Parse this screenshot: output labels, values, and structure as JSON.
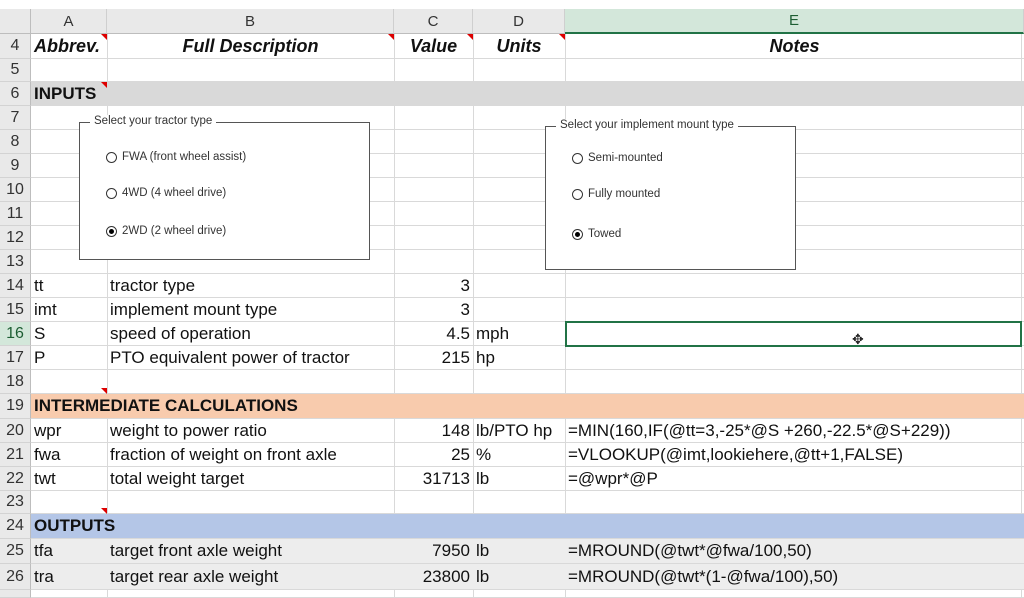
{
  "columns": [
    "A",
    "B",
    "C",
    "D",
    "E"
  ],
  "rows": {
    "r4": {
      "num": "4",
      "a": "Abbrev.",
      "b": "Full Description",
      "c": "Value",
      "d": "Units",
      "e": "Notes"
    },
    "r5": {
      "num": "5"
    },
    "r6": {
      "num": "6",
      "a": "INPUTS"
    },
    "r7": {
      "num": "7"
    },
    "r8": {
      "num": "8"
    },
    "r9": {
      "num": "9"
    },
    "r10": {
      "num": "10"
    },
    "r11": {
      "num": "11"
    },
    "r12": {
      "num": "12"
    },
    "r13": {
      "num": "13"
    },
    "r14": {
      "num": "14",
      "a": "tt",
      "b": "tractor type",
      "c": "3",
      "d": "",
      "e": ""
    },
    "r15": {
      "num": "15",
      "a": "imt",
      "b": "implement mount type",
      "c": "3",
      "d": "",
      "e": ""
    },
    "r16": {
      "num": "16",
      "a": "S",
      "b": "speed of operation",
      "c": "4.5",
      "d": "mph",
      "e": ""
    },
    "r17": {
      "num": "17",
      "a": "P",
      "b": "PTO equivalent power of tractor",
      "c": "215",
      "d": "hp",
      "e": ""
    },
    "r18": {
      "num": "18"
    },
    "r19": {
      "num": "19",
      "a": "INTERMEDIATE CALCULATIONS"
    },
    "r20": {
      "num": "20",
      "a": "wpr",
      "b": "weight to power ratio",
      "c": "148",
      "d": "lb/PTO hp",
      "e": "=MIN(160,IF(@tt=3,-25*@S +260,-22.5*@S+229))"
    },
    "r21": {
      "num": "21",
      "a": "fwa",
      "b": "fraction of weight on front axle",
      "c": "25",
      "d": "%",
      "e": "=VLOOKUP(@imt,lookiehere,@tt+1,FALSE)"
    },
    "r22": {
      "num": "22",
      "a": "twt",
      "b": "total weight target",
      "c": "31713",
      "d": "lb",
      "e": "=@wpr*@P"
    },
    "r23": {
      "num": "23"
    },
    "r24": {
      "num": "24",
      "a": "OUTPUTS"
    },
    "r25": {
      "num": "25",
      "a": "tfa",
      "b": "target front axle weight",
      "c": "7950",
      "d": "lb",
      "e": "=MROUND(@twt*@fwa/100,50)"
    },
    "r26": {
      "num": "26",
      "a": "tra",
      "b": "target rear axle weight",
      "c": "23800",
      "d": "lb",
      "e": "=MROUND(@twt*(1-@fwa/100),50)"
    }
  },
  "tractor_group": {
    "legend": "Select your tractor type",
    "options": [
      {
        "label": "FWA (front wheel assist)",
        "selected": false
      },
      {
        "label": "4WD (4 wheel drive)",
        "selected": false
      },
      {
        "label": "2WD (2 wheel drive)",
        "selected": true
      }
    ]
  },
  "implement_group": {
    "legend": "Select your implement mount type",
    "options": [
      {
        "label": "Semi-mounted",
        "selected": false
      },
      {
        "label": "Fully mounted",
        "selected": false
      },
      {
        "label": "Towed",
        "selected": true
      }
    ]
  },
  "active_cell": "E16",
  "colors": {
    "inputs_band": "#d9d9d9",
    "intermediate_band": "#f8cbad",
    "outputs_band": "#b4c6e7",
    "selection": "#217346"
  }
}
